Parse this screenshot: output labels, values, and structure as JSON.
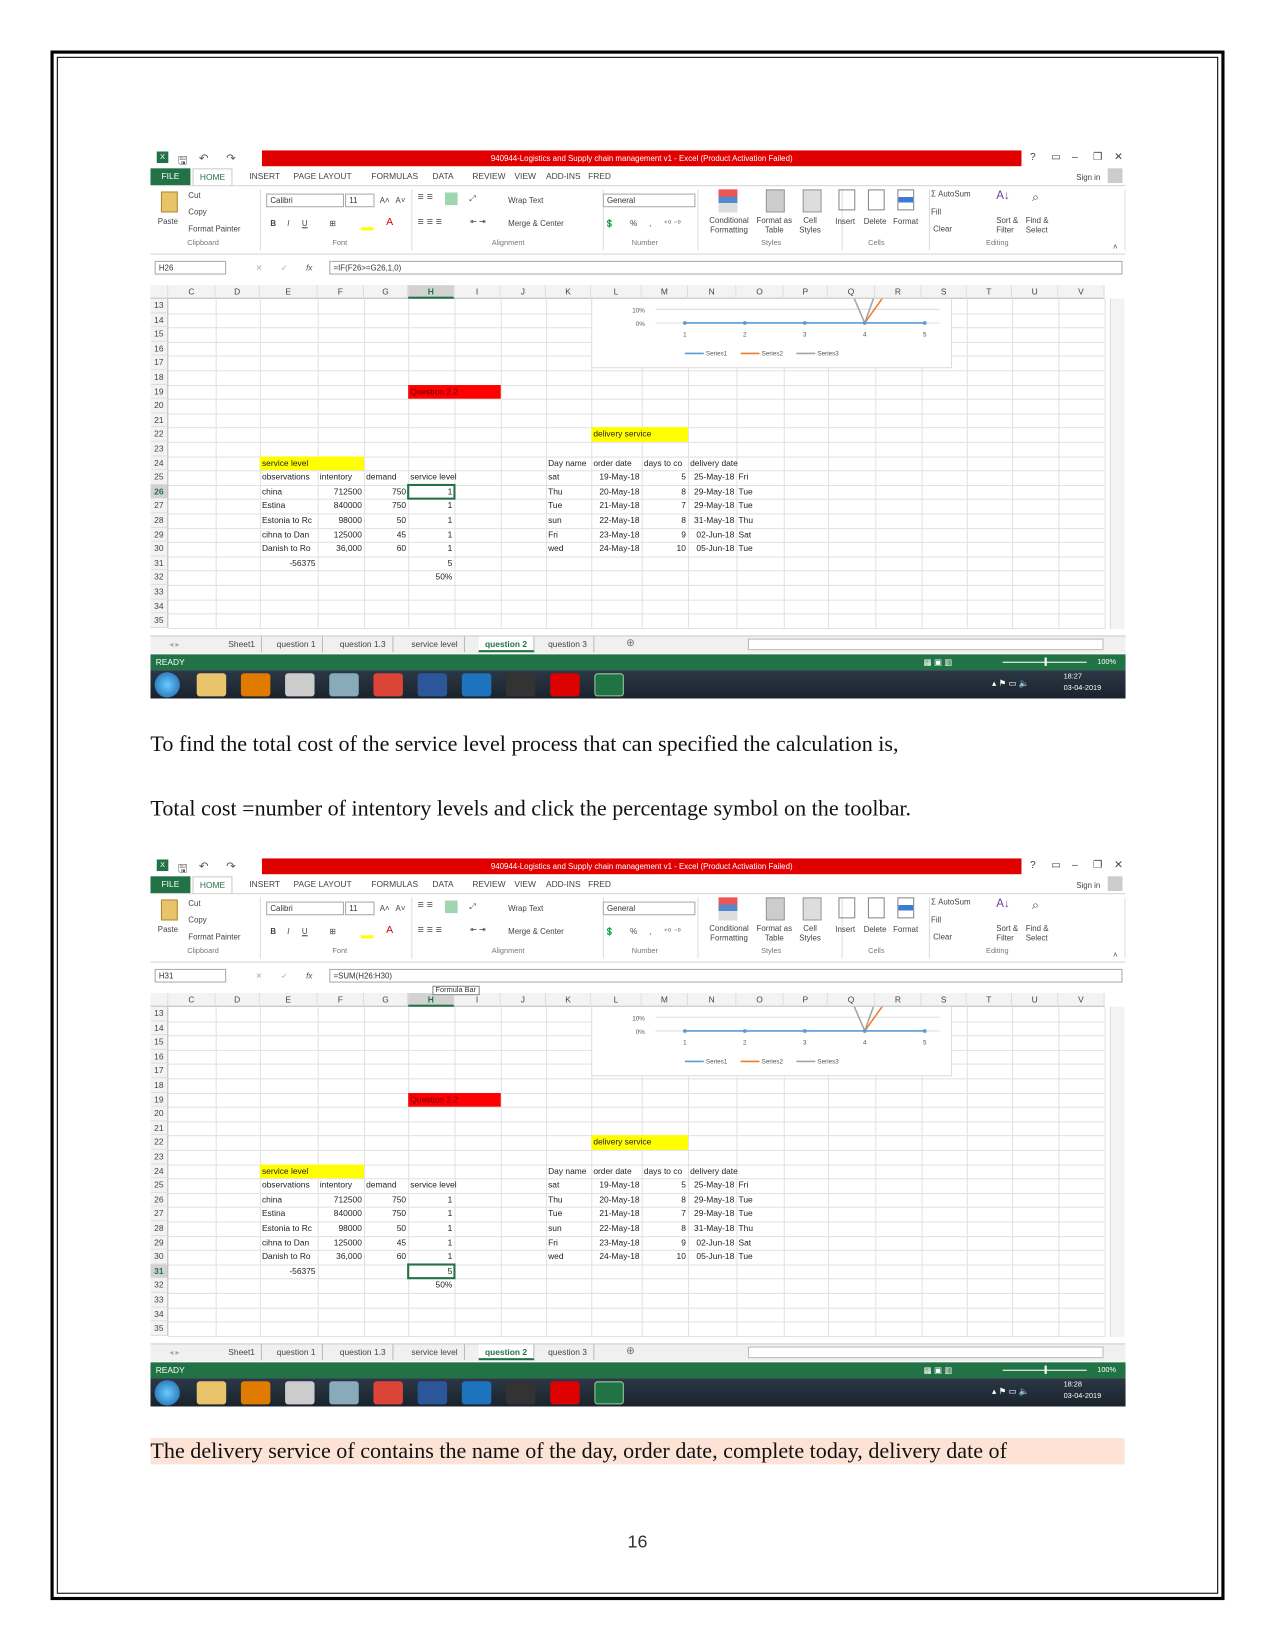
{
  "excel": {
    "title": "940944-Logistics and Supply chain management v1 -  Excel (Product Activation Failed)",
    "window_controls": [
      "?",
      "▭",
      "–",
      "❐",
      "✕"
    ],
    "ribbon_tabs": [
      "FILE",
      "HOME",
      "INSERT",
      "PAGE LAYOUT",
      "FORMULAS",
      "DATA",
      "REVIEW",
      "VIEW",
      "ADD-INS",
      "FRED"
    ],
    "sign_in": "Sign in",
    "clipboard": {
      "paste": "Paste",
      "cut": "Cut",
      "copy": "Copy",
      "format_painter": "Format Painter",
      "label": "Clipboard"
    },
    "font": {
      "name": "Calibri",
      "size": "11",
      "bold": "B",
      "italic": "I",
      "underline": "U",
      "label": "Font"
    },
    "alignment": {
      "wrap": "Wrap Text",
      "merge": "Merge & Center",
      "label": "Alignment"
    },
    "number": {
      "format": "General",
      "percent": "%",
      "comma": ",",
      "label": "Number"
    },
    "styles": {
      "conditional": "Conditional Formatting",
      "table": "Format as Table",
      "cell": "Cell Styles",
      "label": "Styles"
    },
    "cells": {
      "insert": "Insert",
      "delete": "Delete",
      "format": "Format",
      "label": "Cells"
    },
    "editing": {
      "autosum": "AutoSum",
      "fill": "Fill",
      "clear": "Clear",
      "sort": "Sort & Filter",
      "find": "Find & Select",
      "label": "Editing"
    },
    "columns": [
      "C",
      "D",
      "E",
      "F",
      "G",
      "H",
      "I",
      "J",
      "K",
      "L",
      "M",
      "N",
      "O",
      "P",
      "Q",
      "R",
      "S",
      "T",
      "U",
      "V"
    ],
    "row_start": 13,
    "row_end": 35,
    "sheet_tabs": [
      "Sheet1",
      "question 1",
      "question 1.3",
      "service level",
      "question 2",
      "question 3"
    ],
    "active_sheet": "question 2",
    "status": "READY",
    "zoom": "100%",
    "date": "03-04-2019",
    "chart": {
      "y_ticks": [
        "10%",
        "0%"
      ],
      "x_ticks": [
        "1",
        "2",
        "3",
        "4",
        "5"
      ],
      "legend": [
        "Series1",
        "Series2",
        "Series3"
      ],
      "colors": {
        "Series1": "#5b9bd5",
        "Series2": "#ed7d31",
        "Series3": "#a5a5a5"
      }
    },
    "cells_data": [
      {
        "row": 19,
        "col": "H",
        "text": "Question 2.2",
        "fill": "#ff0000",
        "span": 2
      },
      {
        "row": 22,
        "col": "L",
        "text": "delivery service",
        "fill": "#ffff00",
        "span": 2
      },
      {
        "row": 24,
        "col": "E",
        "text": "service level",
        "fill": "#ffff00",
        "span": 2
      },
      {
        "row": 24,
        "col": "K",
        "text": "Day name"
      },
      {
        "row": 24,
        "col": "L",
        "text": "order date"
      },
      {
        "row": 24,
        "col": "M",
        "text": "days to co"
      },
      {
        "row": 24,
        "col": "N",
        "text": "delivery date"
      },
      {
        "row": 25,
        "col": "E",
        "text": "observations"
      },
      {
        "row": 25,
        "col": "F",
        "text": "intentory"
      },
      {
        "row": 25,
        "col": "G",
        "text": "demand"
      },
      {
        "row": 25,
        "col": "H",
        "text": "service level"
      },
      {
        "row": 25,
        "col": "K",
        "text": "sat"
      },
      {
        "row": 25,
        "col": "L",
        "text": "19-May-18"
      },
      {
        "row": 25,
        "col": "M",
        "text": "5"
      },
      {
        "row": 25,
        "col": "N",
        "text": "25-May-18"
      },
      {
        "row": 25,
        "col": "O",
        "text": "Fri"
      },
      {
        "row": 26,
        "col": "E",
        "text": "china"
      },
      {
        "row": 26,
        "col": "F",
        "text": "712500"
      },
      {
        "row": 26,
        "col": "G",
        "text": "750"
      },
      {
        "row": 26,
        "col": "H",
        "text": "1"
      },
      {
        "row": 26,
        "col": "K",
        "text": "Thu"
      },
      {
        "row": 26,
        "col": "L",
        "text": "20-May-18"
      },
      {
        "row": 26,
        "col": "M",
        "text": "8"
      },
      {
        "row": 26,
        "col": "N",
        "text": "29-May-18"
      },
      {
        "row": 26,
        "col": "O",
        "text": "Tue"
      },
      {
        "row": 27,
        "col": "E",
        "text": "Estina"
      },
      {
        "row": 27,
        "col": "F",
        "text": "840000"
      },
      {
        "row": 27,
        "col": "G",
        "text": "750"
      },
      {
        "row": 27,
        "col": "H",
        "text": "1"
      },
      {
        "row": 27,
        "col": "K",
        "text": "Tue"
      },
      {
        "row": 27,
        "col": "L",
        "text": "21-May-18"
      },
      {
        "row": 27,
        "col": "M",
        "text": "7"
      },
      {
        "row": 27,
        "col": "N",
        "text": "29-May-18"
      },
      {
        "row": 27,
        "col": "O",
        "text": "Tue"
      },
      {
        "row": 28,
        "col": "E",
        "text": "Estonia to Rc"
      },
      {
        "row": 28,
        "col": "F",
        "text": "98000"
      },
      {
        "row": 28,
        "col": "G",
        "text": "50"
      },
      {
        "row": 28,
        "col": "H",
        "text": "1"
      },
      {
        "row": 28,
        "col": "K",
        "text": "sun"
      },
      {
        "row": 28,
        "col": "L",
        "text": "22-May-18"
      },
      {
        "row": 28,
        "col": "M",
        "text": "8"
      },
      {
        "row": 28,
        "col": "N",
        "text": "31-May-18"
      },
      {
        "row": 28,
        "col": "O",
        "text": "Thu"
      },
      {
        "row": 29,
        "col": "E",
        "text": "cihna to Dan"
      },
      {
        "row": 29,
        "col": "F",
        "text": "125000"
      },
      {
        "row": 29,
        "col": "G",
        "text": "45"
      },
      {
        "row": 29,
        "col": "H",
        "text": "1"
      },
      {
        "row": 29,
        "col": "K",
        "text": "Fri"
      },
      {
        "row": 29,
        "col": "L",
        "text": "23-May-18"
      },
      {
        "row": 29,
        "col": "M",
        "text": "9"
      },
      {
        "row": 29,
        "col": "N",
        "text": "02-Jun-18"
      },
      {
        "row": 29,
        "col": "O",
        "text": "Sat"
      },
      {
        "row": 30,
        "col": "E",
        "text": "Danish to Ro"
      },
      {
        "row": 30,
        "col": "F",
        "text": "36,000"
      },
      {
        "row": 30,
        "col": "G",
        "text": "60"
      },
      {
        "row": 30,
        "col": "H",
        "text": "1"
      },
      {
        "row": 30,
        "col": "K",
        "text": "wed"
      },
      {
        "row": 30,
        "col": "L",
        "text": "24-May-18"
      },
      {
        "row": 30,
        "col": "M",
        "text": "10"
      },
      {
        "row": 30,
        "col": "N",
        "text": "05-Jun-18"
      },
      {
        "row": 30,
        "col": "O",
        "text": "Tue"
      },
      {
        "row": 31,
        "col": "E",
        "text": "-56375"
      },
      {
        "row": 31,
        "col": "H",
        "text": "5"
      },
      {
        "row": 32,
        "col": "H",
        "text": "50%"
      }
    ]
  },
  "shots": [
    {
      "name_box": "H26",
      "formula": "=IF(F26>=G26,1,0)",
      "selected_col": "H",
      "selected_row": 26,
      "time": "18:27",
      "tooltip": ""
    },
    {
      "name_box": "H31",
      "formula": "=SUM(H26:H30)",
      "selected_col": "H",
      "selected_row": 31,
      "time": "18:28",
      "tooltip": "Formula Bar"
    }
  ],
  "text": {
    "para1": "To find the total cost of the service level process that can specified the calculation is,",
    "para2": "Total cost =number of intentory levels and click the percentage symbol on the toolbar.",
    "para3": "The delivery service of contains the name of the day, order date, complete today, delivery date of",
    "page_number": "16"
  }
}
